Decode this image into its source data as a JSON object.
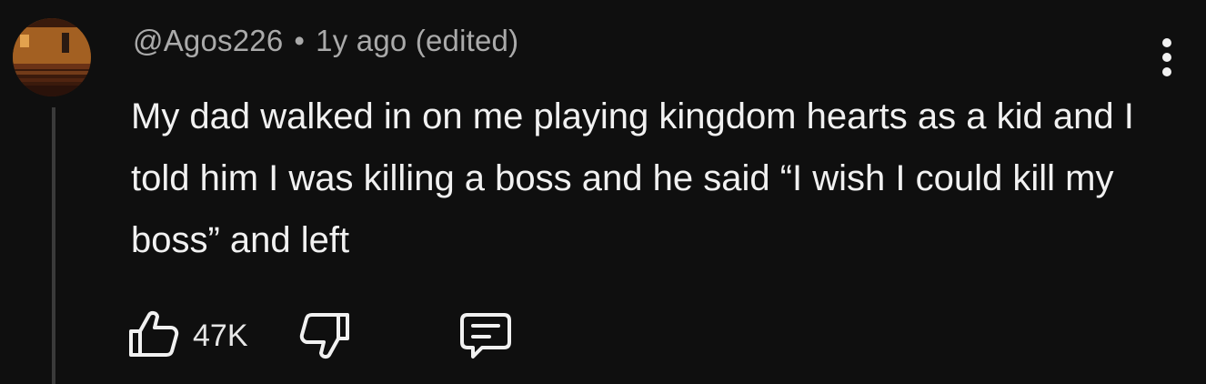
{
  "comment": {
    "author": "@Agos226",
    "separator": "•",
    "timestamp": "1y ago (edited)",
    "text": "My dad walked in on me playing kingdom hearts as a kid and I told him I was killing a boss and he said “I wish I could kill my boss” and left"
  },
  "actions": {
    "like_count": "47K",
    "like_icon": "thumbs-up-icon",
    "dislike_icon": "thumbs-down-icon",
    "reply_icon": "comment-icon",
    "more_icon": "more-vertical-icon"
  },
  "colors": {
    "background": "#0f0f0f",
    "text": "#f1f1f1",
    "meta_text": "#aaaaaa",
    "thread_line": "#3a3a3a"
  }
}
